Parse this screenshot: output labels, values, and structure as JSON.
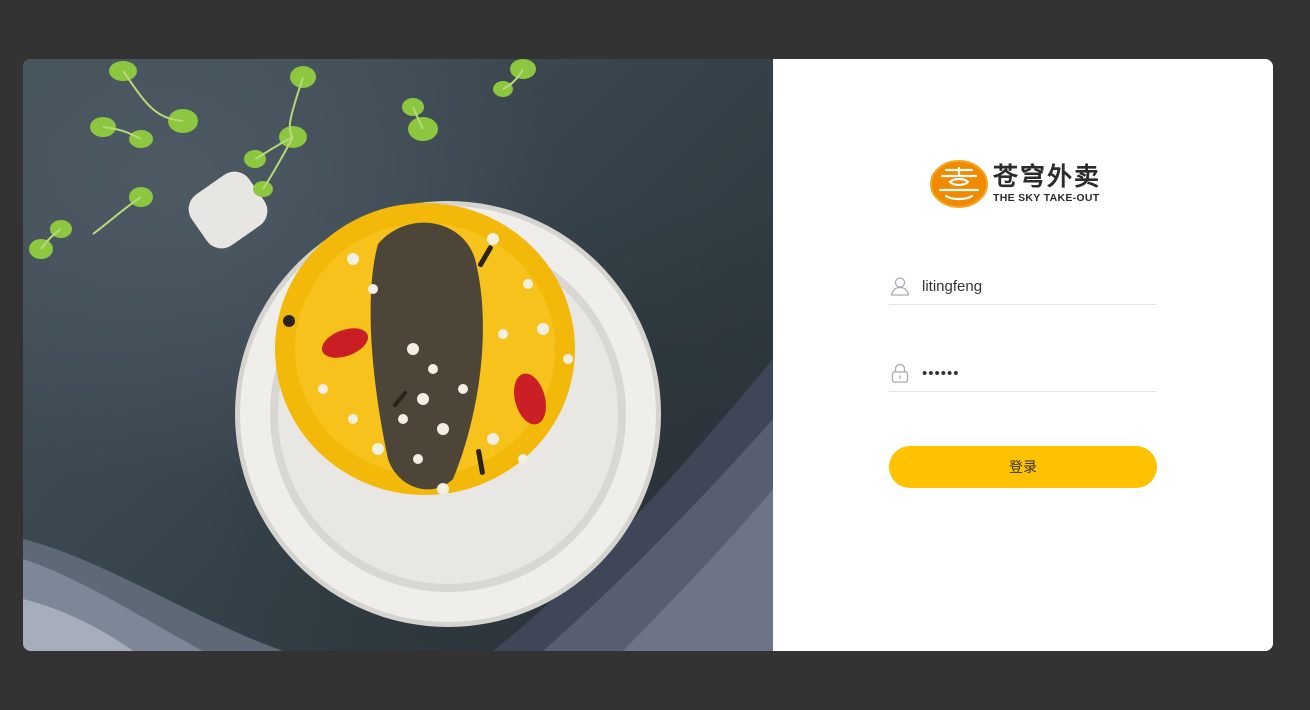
{
  "photo": {
    "alt": "sea cucumber millet soup"
  },
  "brand": {
    "name_cn": "苍穹外卖",
    "name_en": "THE SKY TAKE-OUT",
    "accent": "#ffc200",
    "logo_color": "#f08a00"
  },
  "login": {
    "username": {
      "value": "litingfeng",
      "icon": "user-icon"
    },
    "password": {
      "value": "123456",
      "icon": "lock-icon"
    },
    "submit_label": "登录"
  }
}
